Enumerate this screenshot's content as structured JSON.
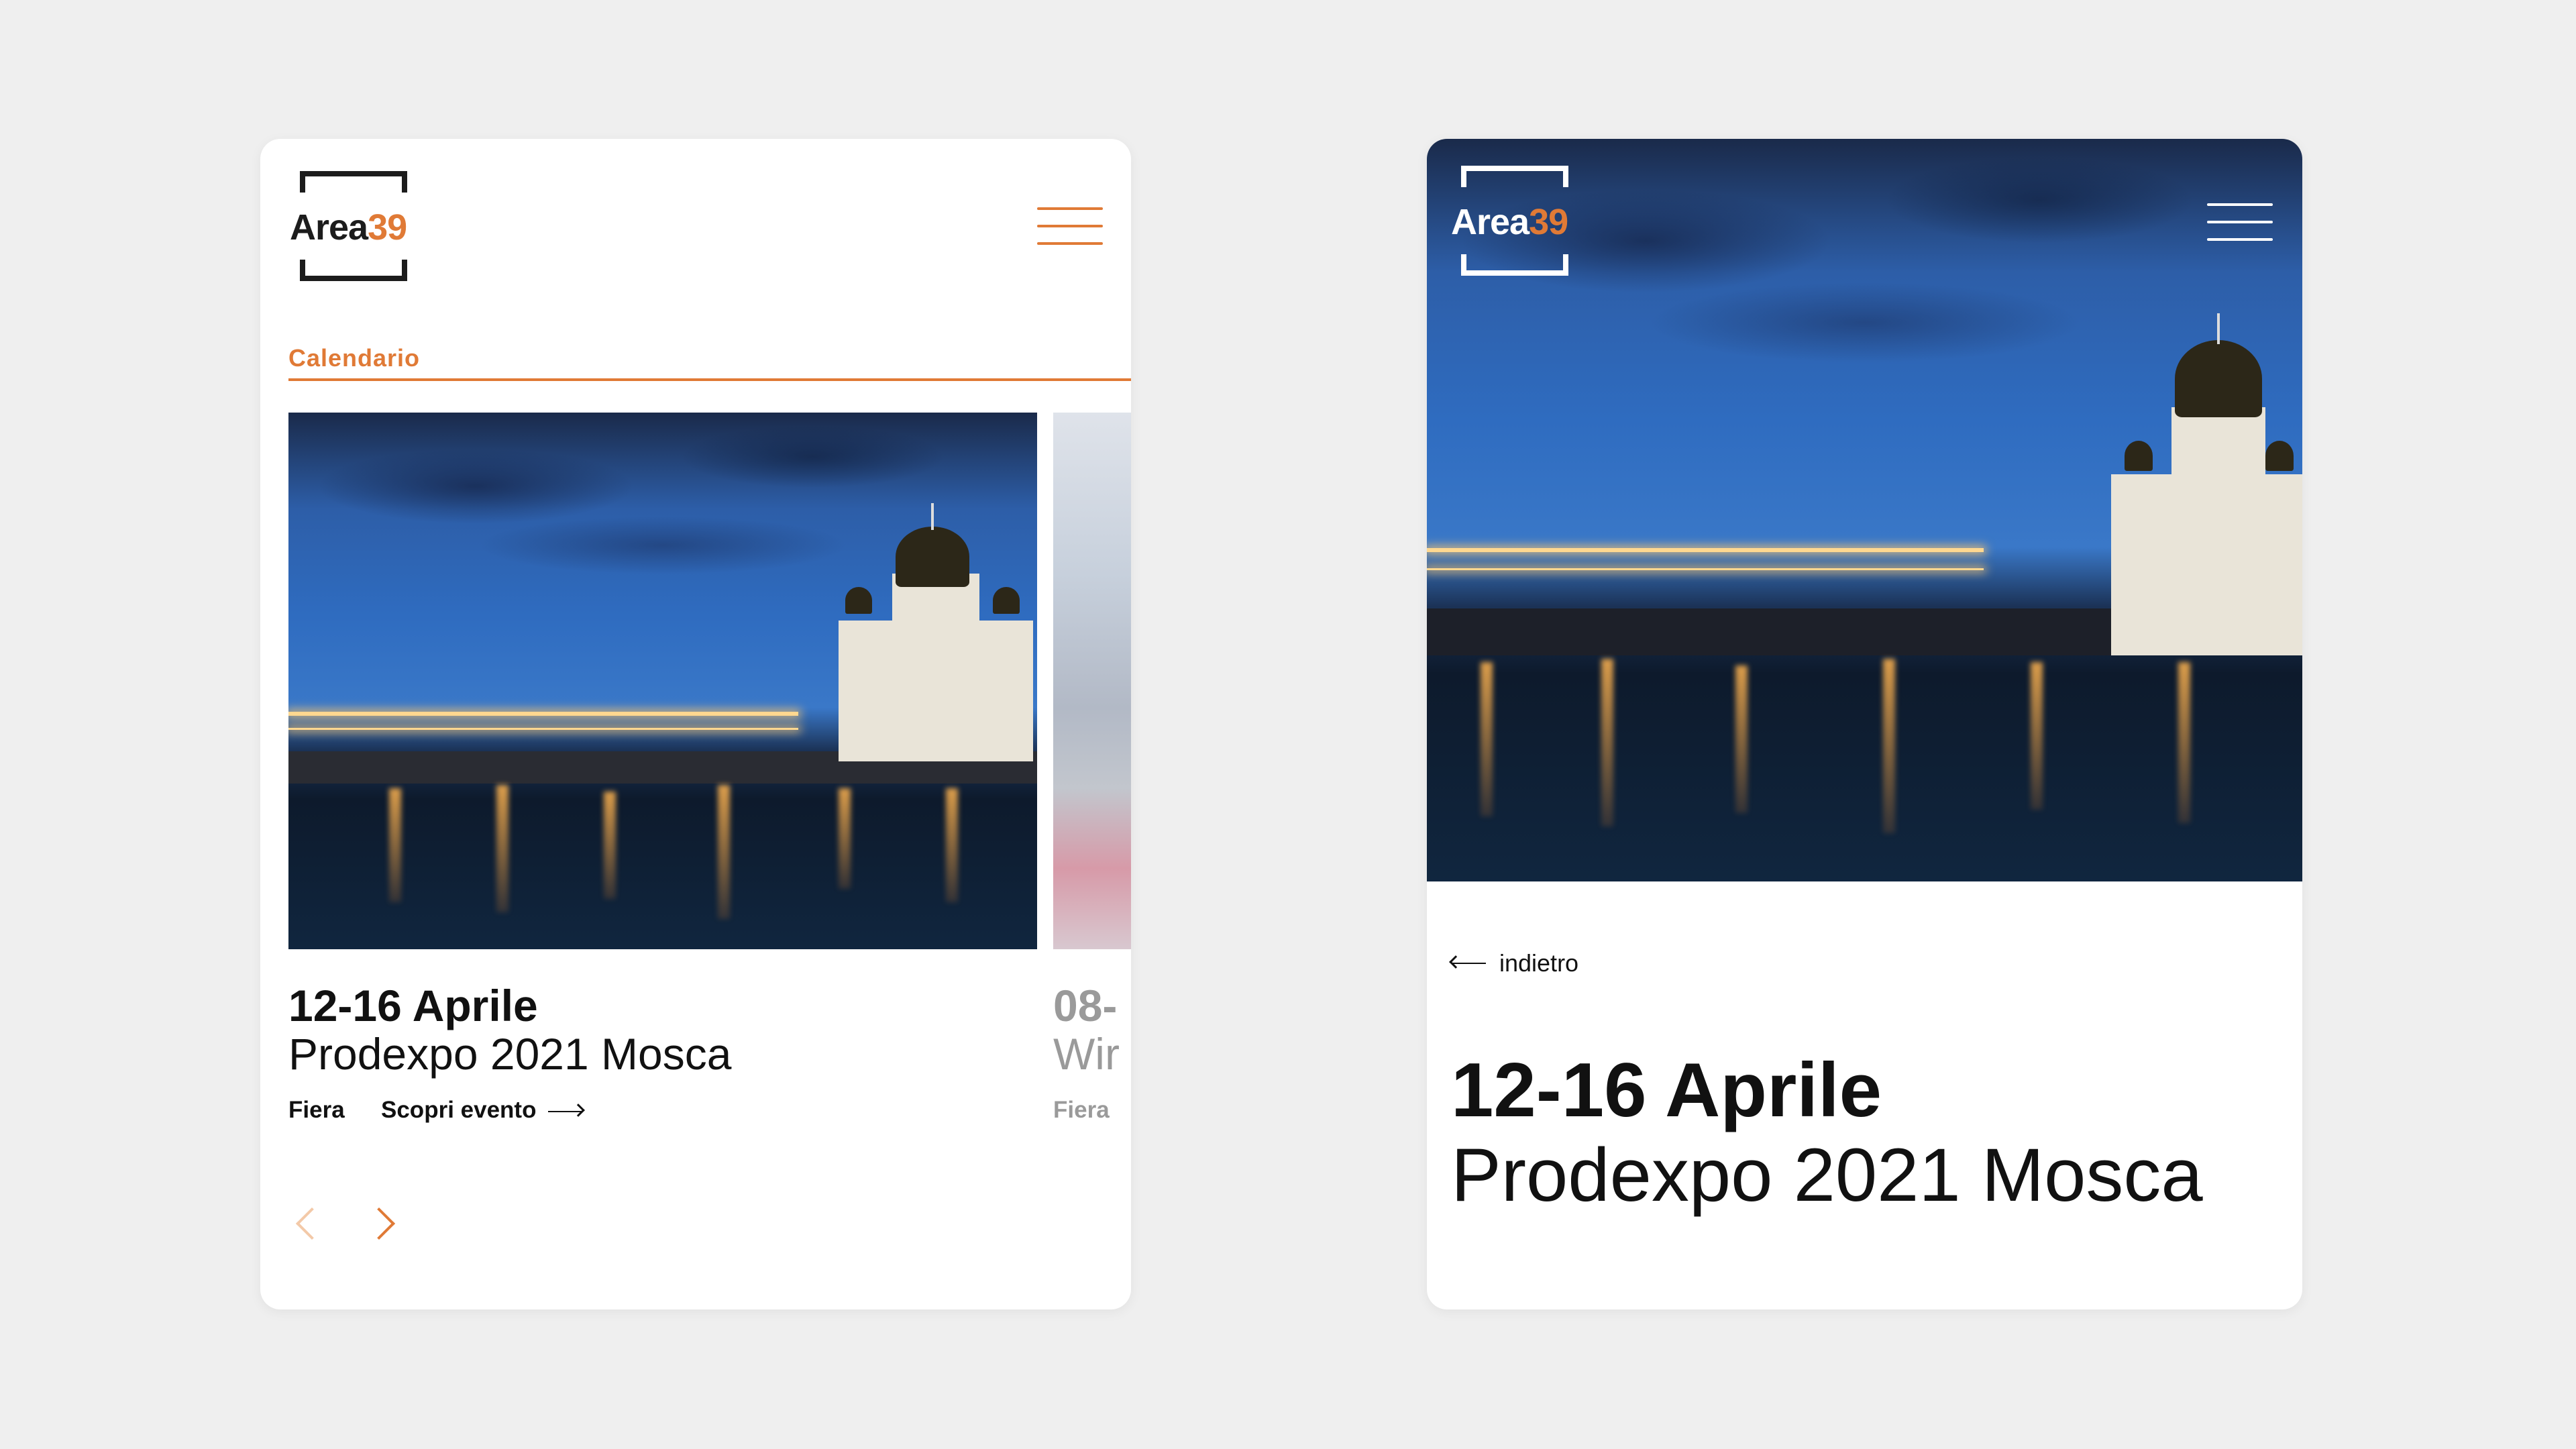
{
  "brand": {
    "name": "Area",
    "number": "39"
  },
  "colors": {
    "accent": "#e07a36",
    "background": "#efefef",
    "card": "#ffffff",
    "text": "#111111"
  },
  "icons": {
    "menu": "hamburger-icon",
    "prev": "chevron-left-icon",
    "next": "chevron-right-icon",
    "arrow": "arrow-right-icon",
    "back": "arrow-left-icon"
  },
  "list_view": {
    "section_label": "Calendario",
    "events": [
      {
        "date": "12-16 Aprile",
        "name": "Prodexpo 2021 Mosca",
        "type": "Fiera",
        "cta": "Scopri evento"
      },
      {
        "date": "08-",
        "name": "Wir",
        "type": "Fiera"
      }
    ]
  },
  "detail_view": {
    "back_label": "indietro",
    "date": "12-16 Aprile",
    "name": "Prodexpo 2021 Mosca"
  }
}
